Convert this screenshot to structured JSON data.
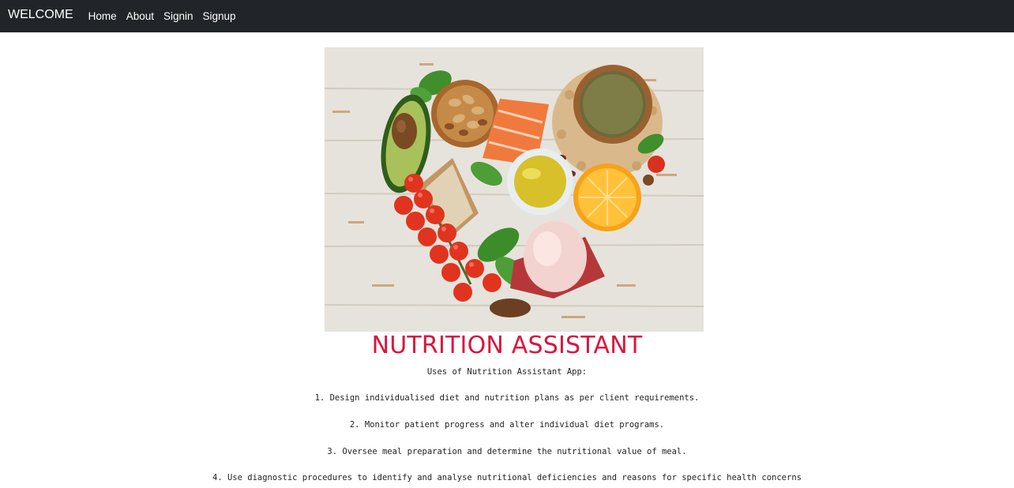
{
  "nav": {
    "brand": "WELCOME",
    "links": [
      "Home",
      "About",
      "Signin",
      "Signup"
    ]
  },
  "hero": {
    "image_icon": "healthy-food-heart-image"
  },
  "main": {
    "title": "NUTRITION ASSISTANT",
    "intro": "Uses of Nutrition Assistant App:",
    "items": [
      "1. Design individualised diet and nutrition plans as per client requirements.",
      "2. Monitor patient progress and alter individual diet programs.",
      "3. Oversee meal preparation and determine the nutritional value of meal.",
      "4. Use diagnostic procedures to identify and analyse nutritional deficiencies and reasons for specific health concerns"
    ]
  },
  "colors": {
    "navbar": "#212529",
    "title": "#dc143c"
  }
}
